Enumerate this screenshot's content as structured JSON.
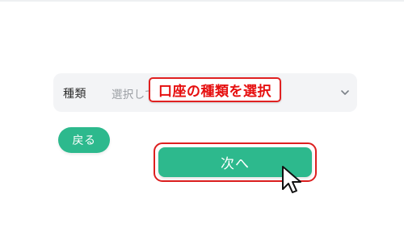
{
  "form": {
    "select_label": "種類",
    "select_placeholder": "選択してください",
    "select_icon": "chevron-down-icon"
  },
  "annotation": {
    "text": "口座の種類を選択",
    "color": "#e60f0f"
  },
  "buttons": {
    "back_label": "戻る",
    "next_label": "次へ",
    "accent_color": "#2db98d"
  },
  "overlay": {
    "cursor_icon": "mouse-pointer-icon",
    "highlight_color": "#dd1f1f"
  }
}
